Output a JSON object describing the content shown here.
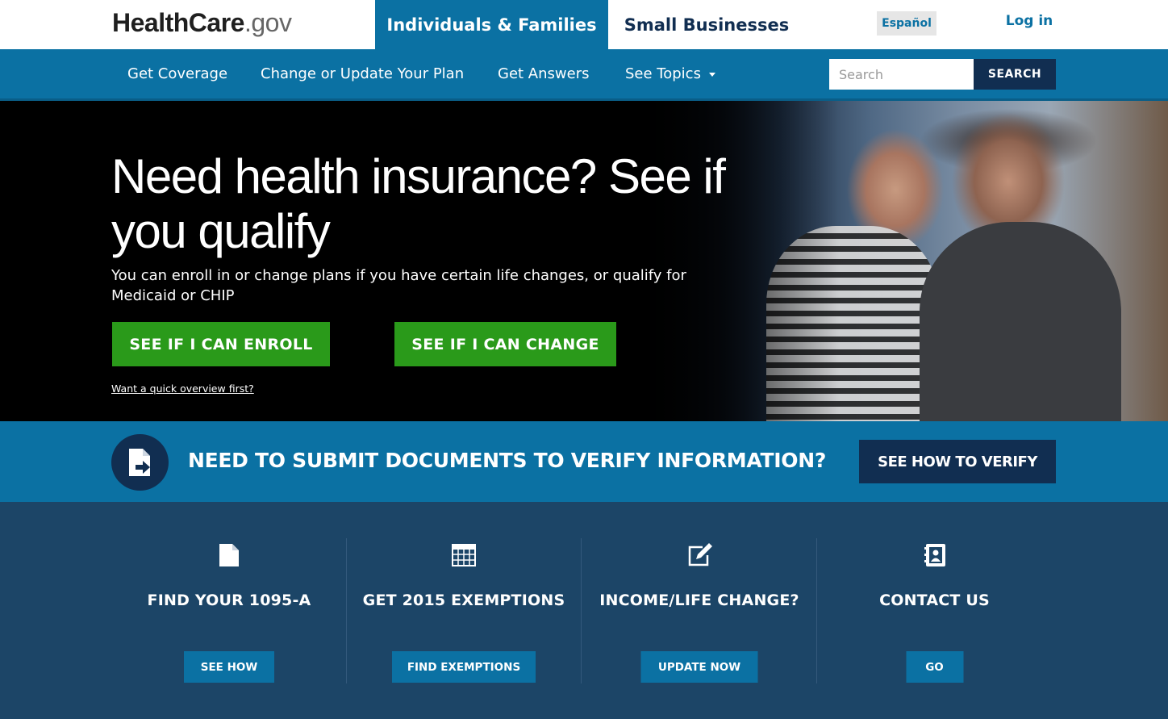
{
  "header": {
    "logo_main": "HealthCare",
    "logo_suffix": ".gov",
    "tab_individuals": "Individuals & Families",
    "tab_small_business": "Small Businesses",
    "language": "Español",
    "login": "Log in"
  },
  "nav": {
    "items": [
      "Get Coverage",
      "Change or Update Your Plan",
      "Get Answers",
      "See Topics"
    ],
    "search_placeholder": "Search",
    "search_button": "SEARCH"
  },
  "hero": {
    "title": "Need health insurance? See if you qualify",
    "subtitle": "You can enroll in or change plans if you have certain life changes, or qualify for Medicaid or CHIP",
    "enroll_button": "SEE IF I CAN ENROLL",
    "change_button": "SEE IF I CAN CHANGE",
    "overview_link": "Want a quick overview first?"
  },
  "verify": {
    "text": "NEED TO SUBMIT DOCUMENTS TO VERIFY INFORMATION?",
    "button": "SEE HOW TO VERIFY"
  },
  "cards": [
    {
      "icon": "document-icon",
      "title": "FIND YOUR 1095-A",
      "button": "SEE HOW"
    },
    {
      "icon": "table-icon",
      "title": "GET 2015 EXEMPTIONS",
      "button": "FIND EXEMPTIONS"
    },
    {
      "icon": "edit-icon",
      "title": "INCOME/LIFE CHANGE?",
      "button": "UPDATE NOW"
    },
    {
      "icon": "contact-book-icon",
      "title": "CONTACT US",
      "button": "GO"
    }
  ],
  "colors": {
    "primary_blue": "#0b71a3",
    "navy": "#112e51",
    "dark_panel": "#1c4567",
    "green": "#2a9a1a"
  }
}
